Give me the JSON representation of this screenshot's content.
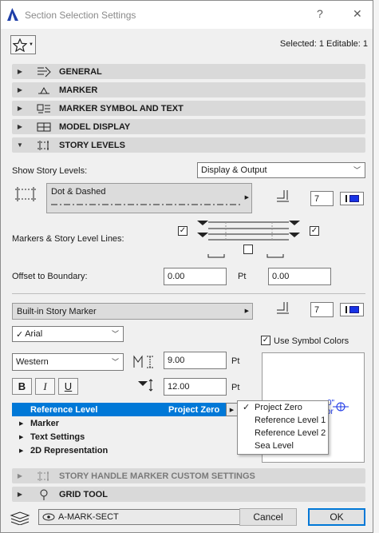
{
  "window": {
    "title": "Section Selection Settings",
    "help": "?",
    "close": "✕"
  },
  "selection_info": "Selected: 1 Editable: 1",
  "sections": {
    "general": "GENERAL",
    "marker": "MARKER",
    "marker_symbol_text": "MARKER SYMBOL AND TEXT",
    "model_display": "MODEL DISPLAY",
    "story_levels": "STORY LEVELS",
    "story_handle": "STORY HANDLE MARKER CUSTOM SETTINGS",
    "grid_tool": "GRID TOOL"
  },
  "story_levels_panel": {
    "show_label": "Show Story Levels:",
    "show_value": "Display & Output",
    "line_type": "Dot & Dashed",
    "pen_number_1": "7",
    "markers_label": "Markers & Story Level Lines:",
    "offset_label": "Offset to Boundary:",
    "offset_value_1": "0.00",
    "offset_unit": "Pt",
    "offset_value_2": "0.00",
    "marker_type": "Built-in Story Marker",
    "pen_number_2": "7",
    "font": "Arial",
    "font_check": "✓",
    "encoding": "Western",
    "size_value": "9.00",
    "size_unit": "Pt",
    "spacing_value": "12.00",
    "spacing_unit": "Pt",
    "bold": "B",
    "italic": "I",
    "underline": "U",
    "use_symbol_colors": "Use Symbol Colors",
    "preview_text_a": "0\"",
    "preview_text_b": "or"
  },
  "tree": [
    {
      "label": "Reference Level",
      "value": "Project Zero"
    },
    {
      "label": "Marker"
    },
    {
      "label": "Text Settings"
    },
    {
      "label": "2D Representation"
    }
  ],
  "dropdown_menu": {
    "check": "✓",
    "items": [
      "Project Zero",
      "Reference Level 1",
      "Reference Level 2",
      "Sea Level"
    ]
  },
  "footer": {
    "layer": "A-MARK-SECT",
    "cancel": "Cancel",
    "ok": "OK"
  },
  "colors": {
    "accent": "#0078d7",
    "pen": "#1733e6"
  }
}
